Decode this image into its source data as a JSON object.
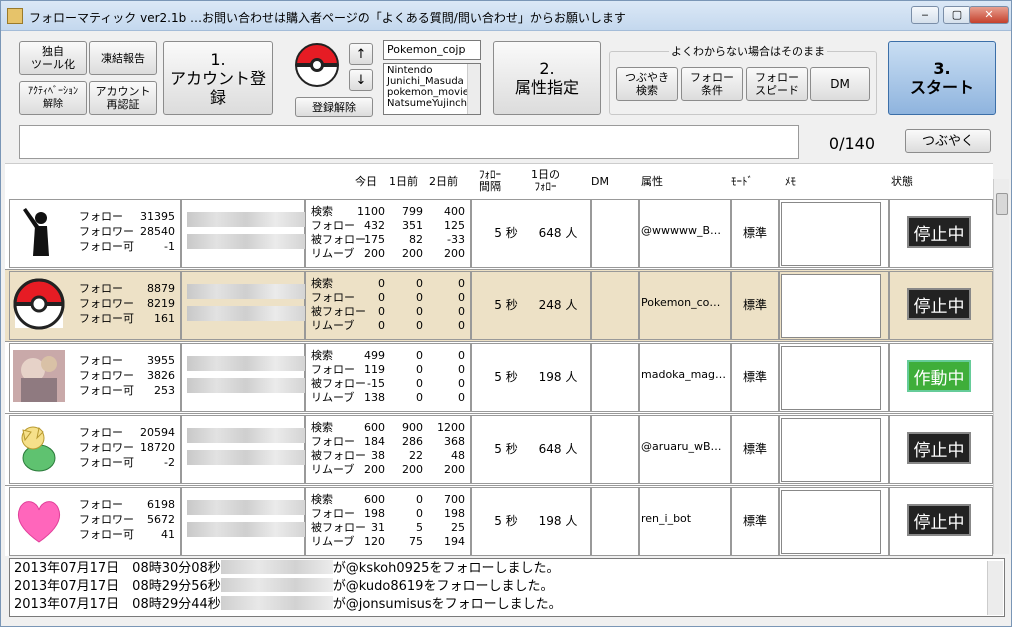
{
  "window": {
    "title": "フォローマティック ver2.1b …お問い合わせは購入者ページの「よくある質問/問い合わせ」からお願いします",
    "min": "‒",
    "max": "▢",
    "close": "✕"
  },
  "toolbar": {
    "dokuji": "独自\nツール化",
    "rentou": "凍結報告",
    "activation": "ｱｸﾃｨﾍﾞｰｼｮﾝ\n解除",
    "reauth": "アカウント\n再認証",
    "register": "1.\nアカウント登録",
    "up": "↑",
    "down": "↓",
    "unregister": "登録解除",
    "account_input": "Pokemon_cojp",
    "account_list": [
      "Nintendo",
      "Junichi_Masuda",
      "pokemon_movie",
      "NatsumeYujincho"
    ],
    "attribute": "2.\n属性指定",
    "group_title": "よくわからない場合はそのまま",
    "tweet_search": "つぶやき\n検索",
    "follow_cond": "フォロー\n条件",
    "follow_speed": "フォロー\nスピード",
    "dm": "DM",
    "start": "3.\nスタート",
    "tweet_btn": "つぶやく",
    "counter": "0/140"
  },
  "table": {
    "headers": {
      "today": "今日",
      "d1": "1日前",
      "d2": "2日前",
      "interval": "ﾌｫﾛｰ\n間隔",
      "daily": "1日の\nﾌｫﾛｰ",
      "dm": "DM",
      "attr": "属性",
      "mode": "ﾓｰﾄﾞ",
      "memo": "ﾒﾓ",
      "status": "状態"
    },
    "labels": {
      "follow": "フォロー",
      "follower": "フォロワー",
      "followable": "フォロー可"
    },
    "grid_labels": [
      "検索",
      "フォロー",
      "被フォロー",
      "リムーブ"
    ],
    "rows": [
      {
        "follow": "31395",
        "follower": "28540",
        "followable": "-1",
        "grid": [
          [
            "1100",
            "799",
            "400"
          ],
          [
            "432",
            "351",
            "125"
          ],
          [
            "175",
            "82",
            "-33"
          ],
          [
            "200",
            "200",
            "200"
          ]
        ],
        "interval": "5 秒",
        "daily": "648 人",
        "attr": "@wwwww_B…",
        "mode": "標準",
        "status": "停止中"
      },
      {
        "follow": "8879",
        "follower": "8219",
        "followable": "161",
        "grid": [
          [
            "0",
            "0",
            "0"
          ],
          [
            "0",
            "0",
            "0"
          ],
          [
            "0",
            "0",
            "0"
          ],
          [
            "0",
            "0",
            "0"
          ]
        ],
        "interval": "5 秒",
        "daily": "248 人",
        "attr": "Pokemon_co…",
        "mode": "標準",
        "status": "停止中"
      },
      {
        "follow": "3955",
        "follower": "3826",
        "followable": "253",
        "grid": [
          [
            "499",
            "0",
            "0"
          ],
          [
            "119",
            "0",
            "0"
          ],
          [
            "-15",
            "0",
            "0"
          ],
          [
            "138",
            "0",
            "0"
          ]
        ],
        "interval": "5 秒",
        "daily": "198 人",
        "attr": "madoka_mag…",
        "mode": "標準",
        "status": "作動中"
      },
      {
        "follow": "20594",
        "follower": "18720",
        "followable": "-2",
        "grid": [
          [
            "600",
            "900",
            "1200"
          ],
          [
            "184",
            "286",
            "368"
          ],
          [
            "38",
            "22",
            "48"
          ],
          [
            "200",
            "200",
            "200"
          ]
        ],
        "interval": "5 秒",
        "daily": "648 人",
        "attr": "@aruaru_wB…",
        "mode": "標準",
        "status": "停止中"
      },
      {
        "follow": "6198",
        "follower": "5672",
        "followable": "41",
        "grid": [
          [
            "600",
            "0",
            "700"
          ],
          [
            "198",
            "0",
            "198"
          ],
          [
            "31",
            "5",
            "25"
          ],
          [
            "120",
            "75",
            "194"
          ]
        ],
        "interval": "5 秒",
        "daily": "198 人",
        "attr": "ren_i_bot",
        "mode": "標準",
        "status": "停止中"
      }
    ]
  },
  "log": [
    {
      "time": "2013年07月17日　08時30分08秒",
      "msg": "が@kskoh0925をフォローしました。"
    },
    {
      "time": "2013年07月17日　08時29分56秒",
      "msg": "が@kudo8619をフォローしました。"
    },
    {
      "time": "2013年07月17日　08時29分44秒",
      "msg": "が@jonsumisusをフォローしました。"
    }
  ],
  "colors": {
    "selected_row": "#ede1c6",
    "running": "#3fae3a",
    "stopped": "#222222"
  }
}
